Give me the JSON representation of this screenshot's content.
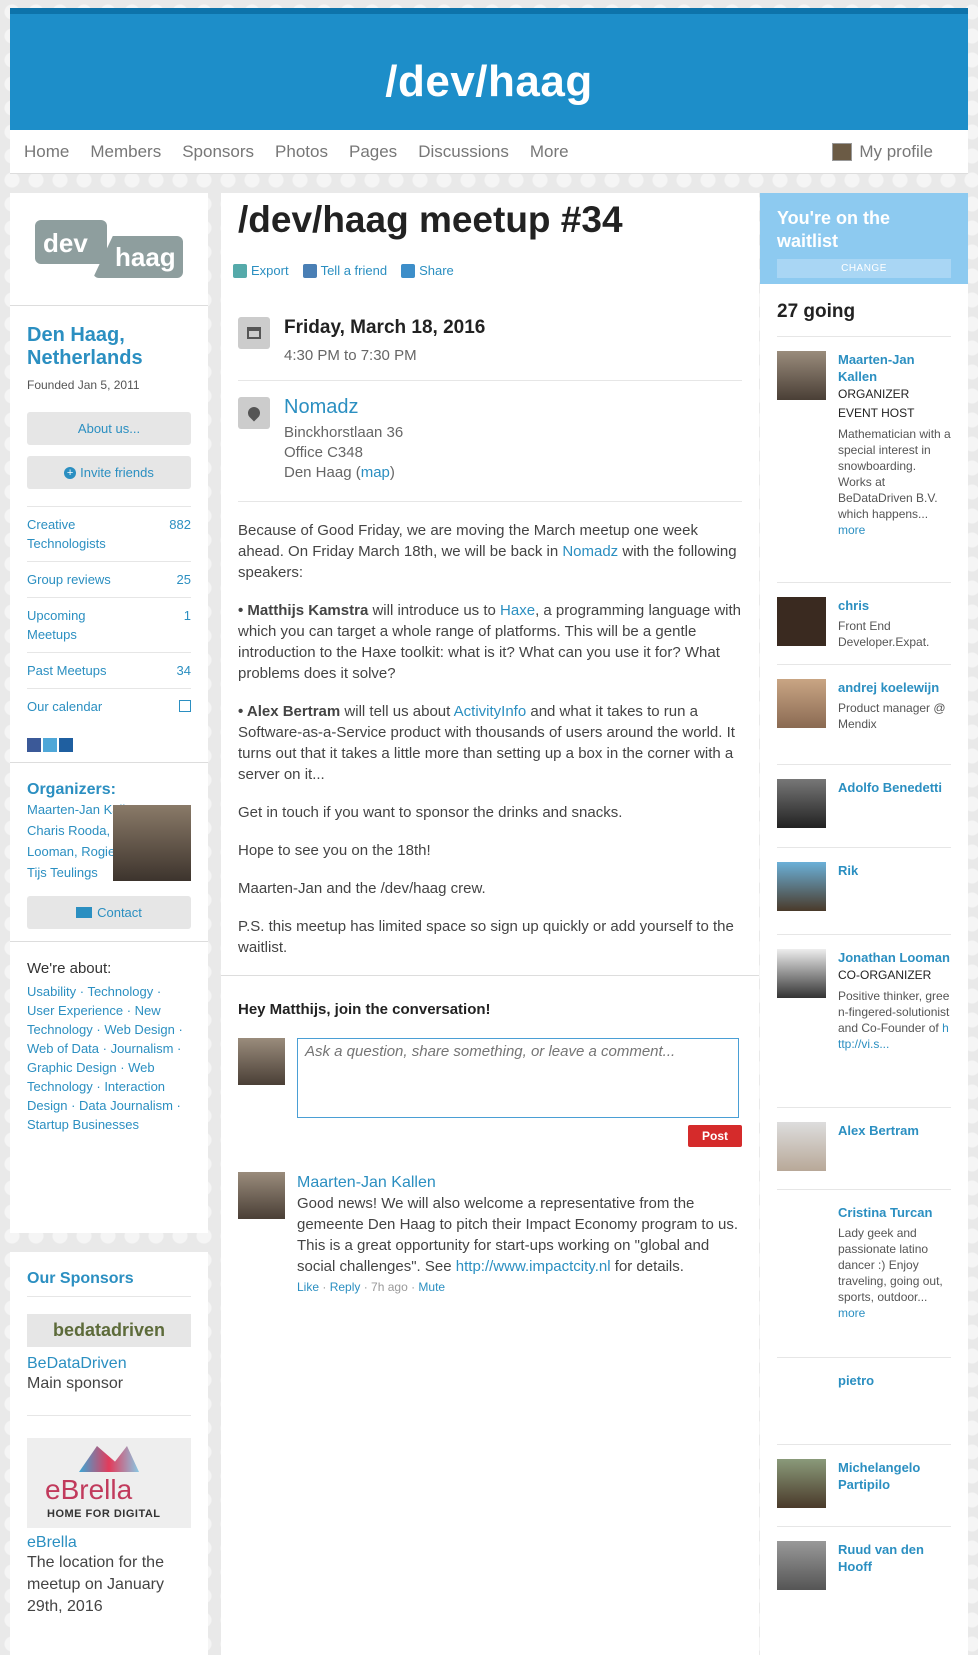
{
  "header": {
    "title": "/dev/haag"
  },
  "nav": {
    "items": [
      "Home",
      "Members",
      "Sponsors",
      "Photos",
      "Pages",
      "Discussions",
      "More"
    ],
    "profile": "My profile"
  },
  "group": {
    "logo_left": "dev",
    "logo_right": "haag",
    "name": "Den Haag, Netherlands",
    "founded": "Founded Jan 5, 2011",
    "about_btn": "About us...",
    "invite_btn": "Invite friends",
    "stats": [
      {
        "label": "Creative Technologists",
        "value": "882"
      },
      {
        "label": "Group reviews",
        "value": "25"
      },
      {
        "label": "Upcoming Meetups",
        "value": "1"
      },
      {
        "label": "Past Meetups",
        "value": "34"
      },
      {
        "label": "Our calendar",
        "value": ""
      }
    ],
    "organizers_title": "Organizers:",
    "organizers_text": "Maarten-Jan Kallen, Charis Rooda, Jonathan Looman, Rogier Chang, Tijs Teulings",
    "contact_btn": "Contact",
    "about_title": "We're about:",
    "topics": "Usability · Technology · User Experience · New Technology · Web Design · Web of Data · Journalism · Graphic Design · Web Technology · Interaction Design · Data Journalism · Startup Businesses"
  },
  "sponsors": {
    "title": "Our Sponsors",
    "items": [
      {
        "logo": "bedatadriven",
        "name": "BeDataDriven",
        "desc": "Main sponsor"
      },
      {
        "logo": "eBrella",
        "tagline": "HOME FOR DIGITAL",
        "name": "eBrella",
        "desc": "The location for the meetup on January 29th, 2016"
      }
    ]
  },
  "event": {
    "title": "/dev/haag meetup #34",
    "actions": [
      "Export",
      "Tell a friend",
      "Share"
    ],
    "date": "Friday, March 18, 2016",
    "time": "4:30 PM to 7:30 PM",
    "venue": "Nomadz",
    "address1": "Binckhorstlaan 36",
    "address2": "Office C348",
    "address3": "Den Haag (",
    "map": "map",
    "address3_end": ")",
    "p1a": "Because of Good Friday, we are moving the March meetup one week ahead. On Friday March 18th, we will be back in ",
    "p1link": "Nomadz",
    "p1b": " with the following speakers:",
    "p2name": "• Matthijs Kamstra",
    "p2a": " will introduce us to ",
    "p2link": "Haxe",
    "p2b": ", a programming language with which you can target a whole range of platforms. This will be a gentle introduction to the Haxe toolkit: what is it? What can you use it for? What problems does it solve?",
    "p3name": "• Alex Bertram",
    "p3a": " will tell us about ",
    "p3link": "ActivityInfo",
    "p3b": " and what it takes to run a Software-as-a-Service product with thousands of users around the world. It turns out that it takes a little more than setting up a box in the corner with a server on it...",
    "p4": "Get in touch if you want to sponsor the drinks and snacks.",
    "p5": "Hope to see you on the 18th!",
    "p6": "Maarten-Jan and the /dev/haag crew.",
    "p7": "P.S. this meetup has limited space so sign up quickly or add yourself to the waitlist."
  },
  "conversation": {
    "title": "Hey Matthijs, join the conversation!",
    "placeholder": "Ask a question, share something, or leave a comment...",
    "post": "Post",
    "comment": {
      "author": "Maarten-Jan Kallen",
      "text_a": "Good news! We will also welcome a representative from the gemeente Den Haag to pitch their Impact Economy program to us. This is a great opportunity for start-ups working on \"global and social challenges\". See ",
      "link": "http://www.impactcity.nl",
      "text_b": " for details.",
      "like": "Like",
      "reply": "Reply",
      "ago": "7h ago",
      "mute": "Mute"
    }
  },
  "rsvp": {
    "status": "You're on the waitlist",
    "change": "CHANGE",
    "going": "27 going",
    "members": [
      {
        "name": "Maarten-Jan Kallen",
        "role1": "ORGANIZER",
        "role2": "EVENT HOST",
        "desc": "Mathematician with a special interest in snowboarding. Works at BeDataDriven B.V. which happens... ",
        "more": "more"
      },
      {
        "name": "chris",
        "desc": "Front End Developer.Expat."
      },
      {
        "name": "andrej koelewijn",
        "desc": "Product manager @ Mendix"
      },
      {
        "name": "Adolfo Benedetti"
      },
      {
        "name": "Rik"
      },
      {
        "name": "Jonathan Looman",
        "role1": "CO-ORGANIZER",
        "desc": "Positive thinker, green-fingered-solutionist and Co-Founder of ",
        "link": "http://vi.s..."
      },
      {
        "name": "Alex Bertram"
      },
      {
        "name": "Cristina Turcan",
        "desc": "Lady geek and passionate latino dancer :) Enjoy traveling, going out, sports, outdoor... ",
        "more": "more"
      },
      {
        "name": "pietro"
      },
      {
        "name": "Michelangelo Partipilo"
      },
      {
        "name": "Ruud van den Hooff"
      }
    ]
  }
}
